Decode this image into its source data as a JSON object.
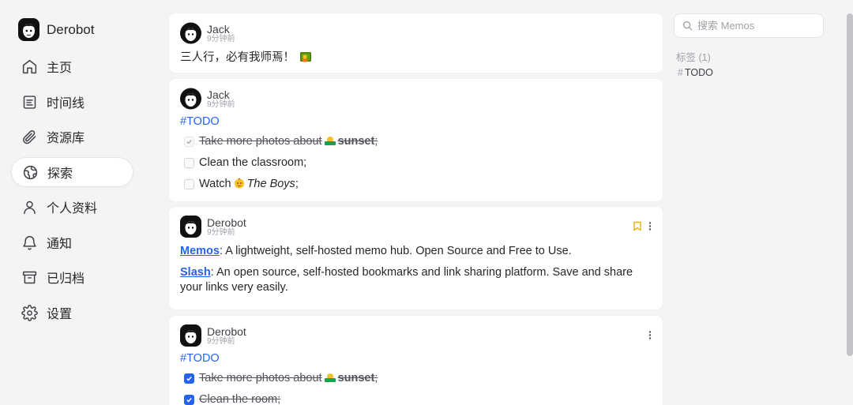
{
  "brand": {
    "name": "Derobot"
  },
  "nav": [
    {
      "label": "主页",
      "icon": "home-icon"
    },
    {
      "label": "时间线",
      "icon": "timeline-icon"
    },
    {
      "label": "资源库",
      "icon": "paperclip-icon"
    },
    {
      "label": "探索",
      "icon": "globe-icon",
      "active": true
    },
    {
      "label": "个人资料",
      "icon": "user-icon"
    },
    {
      "label": "通知",
      "icon": "bell-icon"
    },
    {
      "label": "已归档",
      "icon": "archive-icon"
    },
    {
      "label": "设置",
      "icon": "gear-icon"
    }
  ],
  "memos": [
    {
      "author": "Jack",
      "ago": "9分钟前",
      "text": "三人行，必有我师焉！"
    },
    {
      "author": "Jack",
      "ago": "9分钟前",
      "tag": "#TODO",
      "tasks": [
        {
          "text": "Take more photos about",
          "em": "sunset",
          "suffix": ";",
          "done": true
        },
        {
          "text": "Clean the classroom;",
          "done": false
        },
        {
          "text": "Watch",
          "em": "The Boys",
          "suffix": ";",
          "done": false
        }
      ]
    },
    {
      "author": "Derobot",
      "ago": "9分钟前",
      "links": [
        {
          "name": "Memos",
          "desc": ": A lightweight, self-hosted memo hub. Open Source and Free to Use."
        },
        {
          "name": "Slash",
          "desc": ": An open source, self-hosted bookmarks and link sharing platform. Save and share your links very easily."
        }
      ]
    },
    {
      "author": "Derobot",
      "ago": "9分钟前",
      "tag": "#TODO",
      "tasks": [
        {
          "text": "Take more photos about",
          "em": "sunset",
          "suffix": ";",
          "done": true
        },
        {
          "text": "Clean the room;",
          "done": true
        }
      ]
    }
  ],
  "search": {
    "placeholder": "搜索 Memos"
  },
  "tags": {
    "title": "标签 (1)",
    "items": [
      "TODO"
    ]
  },
  "colors": {
    "accent": "#2563eb",
    "bookmark": "#eab308",
    "background": "#f4f4f5"
  }
}
